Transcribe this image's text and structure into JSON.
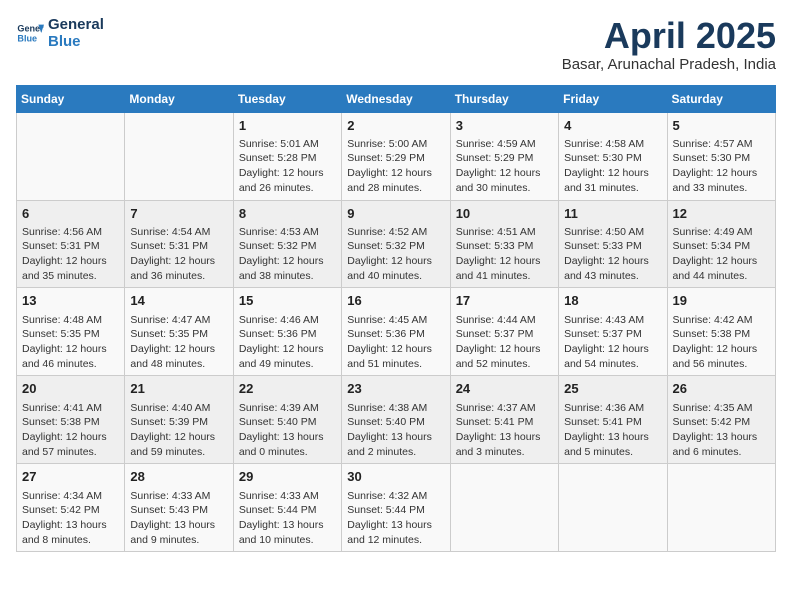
{
  "header": {
    "logo_line1": "General",
    "logo_line2": "Blue",
    "month_title": "April 2025",
    "location": "Basar, Arunachal Pradesh, India"
  },
  "weekdays": [
    "Sunday",
    "Monday",
    "Tuesday",
    "Wednesday",
    "Thursday",
    "Friday",
    "Saturday"
  ],
  "weeks": [
    [
      {
        "day": "",
        "info": ""
      },
      {
        "day": "",
        "info": ""
      },
      {
        "day": "1",
        "info": "Sunrise: 5:01 AM\nSunset: 5:28 PM\nDaylight: 12 hours and 26 minutes."
      },
      {
        "day": "2",
        "info": "Sunrise: 5:00 AM\nSunset: 5:29 PM\nDaylight: 12 hours and 28 minutes."
      },
      {
        "day": "3",
        "info": "Sunrise: 4:59 AM\nSunset: 5:29 PM\nDaylight: 12 hours and 30 minutes."
      },
      {
        "day": "4",
        "info": "Sunrise: 4:58 AM\nSunset: 5:30 PM\nDaylight: 12 hours and 31 minutes."
      },
      {
        "day": "5",
        "info": "Sunrise: 4:57 AM\nSunset: 5:30 PM\nDaylight: 12 hours and 33 minutes."
      }
    ],
    [
      {
        "day": "6",
        "info": "Sunrise: 4:56 AM\nSunset: 5:31 PM\nDaylight: 12 hours and 35 minutes."
      },
      {
        "day": "7",
        "info": "Sunrise: 4:54 AM\nSunset: 5:31 PM\nDaylight: 12 hours and 36 minutes."
      },
      {
        "day": "8",
        "info": "Sunrise: 4:53 AM\nSunset: 5:32 PM\nDaylight: 12 hours and 38 minutes."
      },
      {
        "day": "9",
        "info": "Sunrise: 4:52 AM\nSunset: 5:32 PM\nDaylight: 12 hours and 40 minutes."
      },
      {
        "day": "10",
        "info": "Sunrise: 4:51 AM\nSunset: 5:33 PM\nDaylight: 12 hours and 41 minutes."
      },
      {
        "day": "11",
        "info": "Sunrise: 4:50 AM\nSunset: 5:33 PM\nDaylight: 12 hours and 43 minutes."
      },
      {
        "day": "12",
        "info": "Sunrise: 4:49 AM\nSunset: 5:34 PM\nDaylight: 12 hours and 44 minutes."
      }
    ],
    [
      {
        "day": "13",
        "info": "Sunrise: 4:48 AM\nSunset: 5:35 PM\nDaylight: 12 hours and 46 minutes."
      },
      {
        "day": "14",
        "info": "Sunrise: 4:47 AM\nSunset: 5:35 PM\nDaylight: 12 hours and 48 minutes."
      },
      {
        "day": "15",
        "info": "Sunrise: 4:46 AM\nSunset: 5:36 PM\nDaylight: 12 hours and 49 minutes."
      },
      {
        "day": "16",
        "info": "Sunrise: 4:45 AM\nSunset: 5:36 PM\nDaylight: 12 hours and 51 minutes."
      },
      {
        "day": "17",
        "info": "Sunrise: 4:44 AM\nSunset: 5:37 PM\nDaylight: 12 hours and 52 minutes."
      },
      {
        "day": "18",
        "info": "Sunrise: 4:43 AM\nSunset: 5:37 PM\nDaylight: 12 hours and 54 minutes."
      },
      {
        "day": "19",
        "info": "Sunrise: 4:42 AM\nSunset: 5:38 PM\nDaylight: 12 hours and 56 minutes."
      }
    ],
    [
      {
        "day": "20",
        "info": "Sunrise: 4:41 AM\nSunset: 5:38 PM\nDaylight: 12 hours and 57 minutes."
      },
      {
        "day": "21",
        "info": "Sunrise: 4:40 AM\nSunset: 5:39 PM\nDaylight: 12 hours and 59 minutes."
      },
      {
        "day": "22",
        "info": "Sunrise: 4:39 AM\nSunset: 5:40 PM\nDaylight: 13 hours and 0 minutes."
      },
      {
        "day": "23",
        "info": "Sunrise: 4:38 AM\nSunset: 5:40 PM\nDaylight: 13 hours and 2 minutes."
      },
      {
        "day": "24",
        "info": "Sunrise: 4:37 AM\nSunset: 5:41 PM\nDaylight: 13 hours and 3 minutes."
      },
      {
        "day": "25",
        "info": "Sunrise: 4:36 AM\nSunset: 5:41 PM\nDaylight: 13 hours and 5 minutes."
      },
      {
        "day": "26",
        "info": "Sunrise: 4:35 AM\nSunset: 5:42 PM\nDaylight: 13 hours and 6 minutes."
      }
    ],
    [
      {
        "day": "27",
        "info": "Sunrise: 4:34 AM\nSunset: 5:42 PM\nDaylight: 13 hours and 8 minutes."
      },
      {
        "day": "28",
        "info": "Sunrise: 4:33 AM\nSunset: 5:43 PM\nDaylight: 13 hours and 9 minutes."
      },
      {
        "day": "29",
        "info": "Sunrise: 4:33 AM\nSunset: 5:44 PM\nDaylight: 13 hours and 10 minutes."
      },
      {
        "day": "30",
        "info": "Sunrise: 4:32 AM\nSunset: 5:44 PM\nDaylight: 13 hours and 12 minutes."
      },
      {
        "day": "",
        "info": ""
      },
      {
        "day": "",
        "info": ""
      },
      {
        "day": "",
        "info": ""
      }
    ]
  ]
}
